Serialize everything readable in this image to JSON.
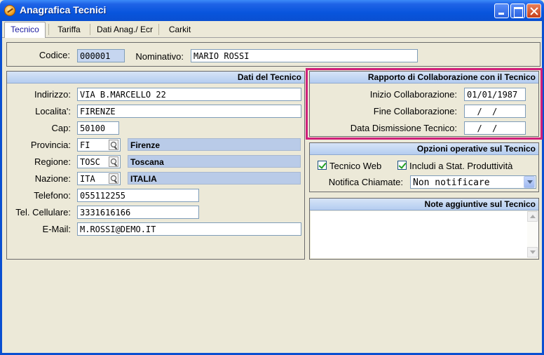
{
  "window": {
    "title": "Anagrafica Tecnici"
  },
  "tabs": [
    {
      "label": "Tecnico"
    },
    {
      "label": "Tariffa"
    },
    {
      "label": "Dati Anag./ Ecr"
    },
    {
      "label": "Carkit"
    }
  ],
  "header": {
    "codice_label": "Codice:",
    "codice_value": "000001",
    "nominativo_label": "Nominativo:",
    "nominativo_value": "MARIO ROSSI"
  },
  "dati_tecnico": {
    "title": "Dati del Tecnico",
    "indirizzo_label": "Indirizzo:",
    "indirizzo_value": "VIA B.MARCELLO 22",
    "localita_label": "Localita':",
    "localita_value": "FIRENZE",
    "cap_label": "Cap:",
    "cap_value": "50100",
    "provincia_label": "Provincia:",
    "provincia_code": "FI",
    "provincia_name": "Firenze",
    "regione_label": "Regione:",
    "regione_code": "TOSC",
    "regione_name": "Toscana",
    "nazione_label": "Nazione:",
    "nazione_code": "ITA",
    "nazione_name": "ITALIA",
    "telefono_label": "Telefono:",
    "telefono_value": "055112255",
    "cellulare_label": "Tel. Cellulare:",
    "cellulare_value": "3331616166",
    "email_label": "E-Mail:",
    "email_value": "M.ROSSI@DEMO.IT"
  },
  "collaborazione": {
    "title": "Rapporto di Collaborazione con il Tecnico",
    "inizio_label": "Inizio Collaborazione:",
    "inizio_value": "01/01/1987",
    "fine_label": "Fine Collaborazione:",
    "fine_value": "  /  /",
    "dismissione_label": "Data Dismissione Tecnico:",
    "dismissione_value": "  /  /"
  },
  "opzioni": {
    "title": "Opzioni operative sul Tecnico",
    "tecnico_web_label": "Tecnico Web",
    "tecnico_web_checked": true,
    "stat_label": "Includi a Stat. Produttività",
    "stat_checked": true,
    "notifica_label": "Notifica Chiamate:",
    "notifica_value": "Non notificare"
  },
  "note": {
    "title": "Note aggiuntive sul Tecnico",
    "text": ""
  },
  "colors": {
    "titlebar": "#0A4FD1",
    "highlight": "#D0207A",
    "section_header": "#B5CDF0",
    "window_bg": "#ECE9D8"
  }
}
